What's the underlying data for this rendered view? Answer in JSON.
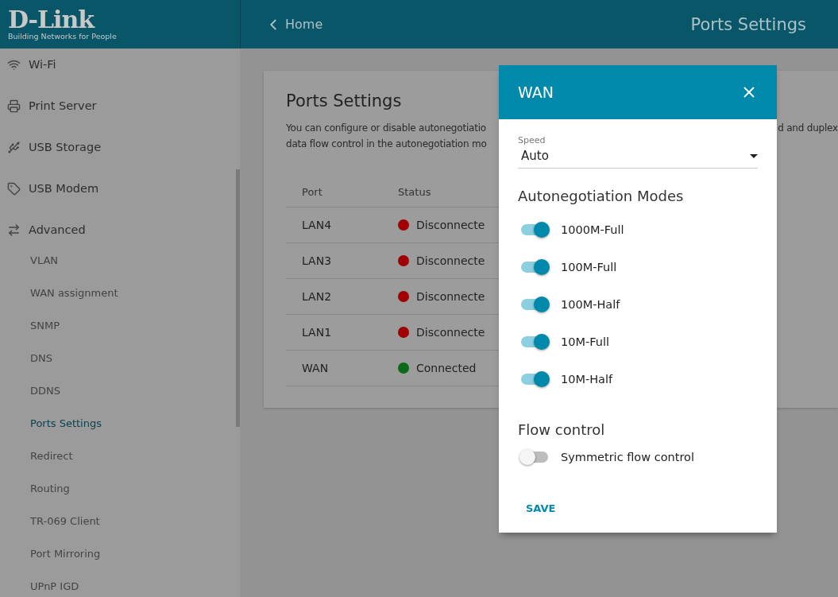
{
  "logo": {
    "brand": "D-Link",
    "tagline": "Building Networks for People"
  },
  "header": {
    "back": "Home",
    "title": "Ports Settings"
  },
  "sidebar": {
    "items": [
      {
        "label": "Wi-Fi",
        "kind": "wifi",
        "selected": false
      },
      {
        "label": "Print Server",
        "kind": "printer",
        "selected": false
      },
      {
        "label": "USB Storage",
        "kind": "usb",
        "selected": false
      },
      {
        "label": "USB Modem",
        "kind": "modem",
        "selected": false
      },
      {
        "label": "Advanced",
        "kind": "advanced",
        "selected": false,
        "children": [
          {
            "label": "VLAN",
            "selected": false
          },
          {
            "label": "WAN assignment",
            "selected": false
          },
          {
            "label": "SNMP",
            "selected": false
          },
          {
            "label": "DNS",
            "selected": false
          },
          {
            "label": "DDNS",
            "selected": false
          },
          {
            "label": "Ports Settings",
            "selected": true
          },
          {
            "label": "Redirect",
            "selected": false
          },
          {
            "label": "Routing",
            "selected": false
          },
          {
            "label": "TR-069 Client",
            "selected": false
          },
          {
            "label": "Port Mirroring",
            "selected": false
          },
          {
            "label": "UPnP IGD",
            "selected": false
          }
        ]
      }
    ]
  },
  "card": {
    "title": "Ports Settings",
    "description_lines": [
      "You can configure or disable autonegotiatio",
      "data flow control in the autonegotiation mo"
    ],
    "description_right": "d and duplex",
    "columns": [
      "Port",
      "Status"
    ],
    "rows": [
      {
        "port": "LAN4",
        "status": "Disconnecte",
        "color": "#a00000"
      },
      {
        "port": "LAN3",
        "status": "Disconnecte",
        "color": "#a00000"
      },
      {
        "port": "LAN2",
        "status": "Disconnecte",
        "color": "#a00000"
      },
      {
        "port": "LAN1",
        "status": "Disconnecte",
        "color": "#a00000"
      },
      {
        "port": "WAN",
        "status": "Connected",
        "color": "#0a6a1a"
      }
    ]
  },
  "dialog": {
    "title": "WAN",
    "speed_label": "Speed",
    "speed_value": "Auto",
    "modes_title": "Autonegotiation Modes",
    "modes": [
      {
        "label": "1000M-Full",
        "on": true
      },
      {
        "label": "100M-Full",
        "on": true
      },
      {
        "label": "100M-Half",
        "on": true
      },
      {
        "label": "10M-Full",
        "on": true
      },
      {
        "label": "10M-Half",
        "on": true
      }
    ],
    "flow_title": "Flow control",
    "flow": [
      {
        "label": "Symmetric flow control",
        "on": false
      }
    ],
    "save": "SAVE"
  }
}
